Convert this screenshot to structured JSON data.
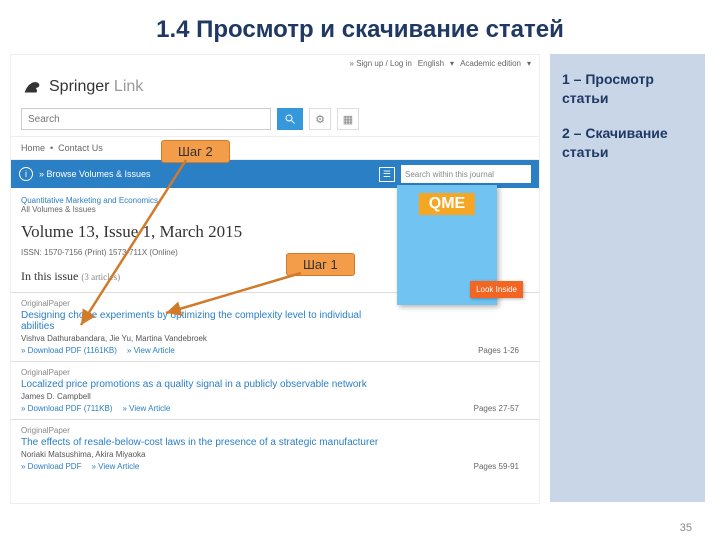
{
  "slide": {
    "title": "1.4 Просмотр и скачивание статей",
    "page_number": "35"
  },
  "right_panel": {
    "line1": "1 – Просмотр статьи",
    "line2": "2 – Скачивание статьи"
  },
  "callouts": {
    "step1": "Шаг 1",
    "step2": "Шаг 2"
  },
  "topbar": {
    "signup": "» Sign up / Log in",
    "lang": "English",
    "edition": "Academic edition"
  },
  "logo": {
    "brand": "Springer",
    "suffix": " Link"
  },
  "search": {
    "placeholder": "Search"
  },
  "breadcrumb": {
    "home": "Home",
    "contact": "Contact Us"
  },
  "bluebar": {
    "browse": "» Browse Volumes & Issues",
    "journal_search": "Search within this journal"
  },
  "journal": {
    "name": "Quantitative Marketing and Economics",
    "all": "All Volumes & Issues",
    "volume_title": "Volume 13, Issue 1, March 2015",
    "issn": "ISSN: 1570-7156 (Print) 1573-711X (Online)",
    "in_issue": "In this issue",
    "count": "(3 articles)"
  },
  "cover": {
    "qme": "QME",
    "look": "Look Inside"
  },
  "articles": [
    {
      "type": "OriginalPaper",
      "title": "Designing choice experiments by optimizing the complexity level to individual abilities",
      "authors": "Vishva Dathurabandara, Jie Yu, Martina Vandebroek",
      "download": "Download PDF (1161KB)",
      "view": "» View Article",
      "pages": "Pages 1-26"
    },
    {
      "type": "OriginalPaper",
      "title": "Localized price promotions as a quality signal in a publicly observable network",
      "authors": "James D. Campbell",
      "download": "Download PDF (711KB)",
      "view": "» View Article",
      "pages": "Pages 27-57"
    },
    {
      "type": "OriginalPaper",
      "title": "The effects of resale-below-cost laws in the presence of a strategic manufacturer",
      "authors": "Noriaki Matsushima, Akira Miyaoka",
      "download": "Download PDF",
      "view": "» View Article",
      "pages": "Pages 59-91"
    }
  ]
}
